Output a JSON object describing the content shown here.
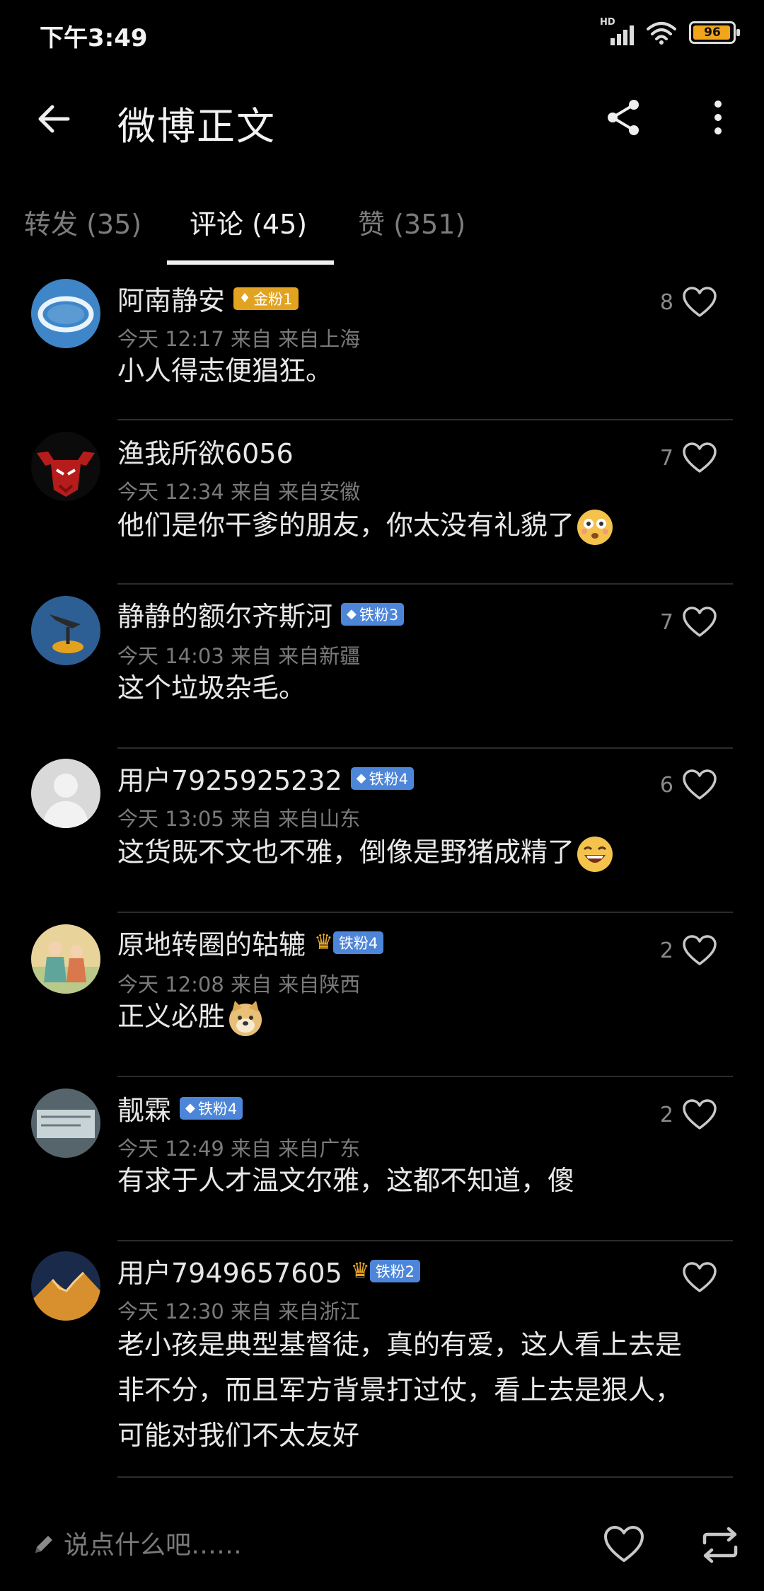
{
  "status_bar": {
    "time": "下午3:49",
    "network": "HD",
    "battery": "96",
    "battery_level_percent": 96
  },
  "header": {
    "title": "微博正文",
    "icons": [
      "back-arrow-icon",
      "share-icon",
      "more-vertical-icon"
    ]
  },
  "tabs": [
    {
      "label": "转发 (35)",
      "active": false
    },
    {
      "label": "评论 (45)",
      "active": true
    },
    {
      "label": "赞 (351)",
      "active": false
    }
  ],
  "comments": [
    {
      "name": "阿南静安",
      "badge": "金粉1",
      "badge_type": "gold",
      "meta": "今天 12:17 来自 来自上海",
      "text": "小人得志便猖狂。",
      "likes": "8"
    },
    {
      "name": "渔我所欲6056",
      "badge": "",
      "meta": "今天 12:34 来自 来自安徽",
      "text": "他们是你干爹的朋友，你太没有礼貌了",
      "emoji": "flushed-emoji",
      "likes": "7"
    },
    {
      "name": "静静的额尔齐斯河",
      "badge": "铁粉3",
      "badge_type": "iron",
      "meta": "今天 14:03 来自 来自新疆",
      "text": "这个垃圾杂毛。",
      "likes": "7"
    },
    {
      "name": "用户7925925232",
      "badge": "铁粉4",
      "badge_type": "iron",
      "meta": "今天 13:05 来自 来自山东",
      "text": "这货既不文也不雅，倒像是野猪成精了",
      "emoji": "laughing-emoji",
      "likes": "6"
    },
    {
      "name": "原地转圈的轱辘",
      "badge": "铁粉4",
      "badge_type": "iron",
      "crown": true,
      "meta": "今天 12:08 来自 来自陕西",
      "text": "正义必胜",
      "emoji": "doge-emoji",
      "likes": "2"
    },
    {
      "name": "靓霖",
      "badge": "铁粉4",
      "badge_type": "iron",
      "meta": "今天 12:49 来自 来自广东",
      "text": "有求于人才温文尔雅，这都不知道，傻",
      "likes": "2"
    },
    {
      "name": "用户7949657605",
      "badge": "铁粉2",
      "badge_type": "iron",
      "crown": true,
      "meta": "今天 12:30 来自 来自浙江",
      "text_lines": [
        "老小孩是典型基督徒，真的有爱，这人看上去是",
        "非不分，而且军方背景打过仗，看上去是狠人，",
        "可能对我们不太友好"
      ],
      "likes": ""
    }
  ],
  "bottom_bar": {
    "input_placeholder": "说点什么吧……",
    "icons": [
      "pencil-icon",
      "heart-icon",
      "repost-icon"
    ]
  },
  "colors": {
    "background": "#000000",
    "gold_badge": "#e2a322",
    "iron_badge": "#4d86d9",
    "battery": "#f0a51c"
  }
}
